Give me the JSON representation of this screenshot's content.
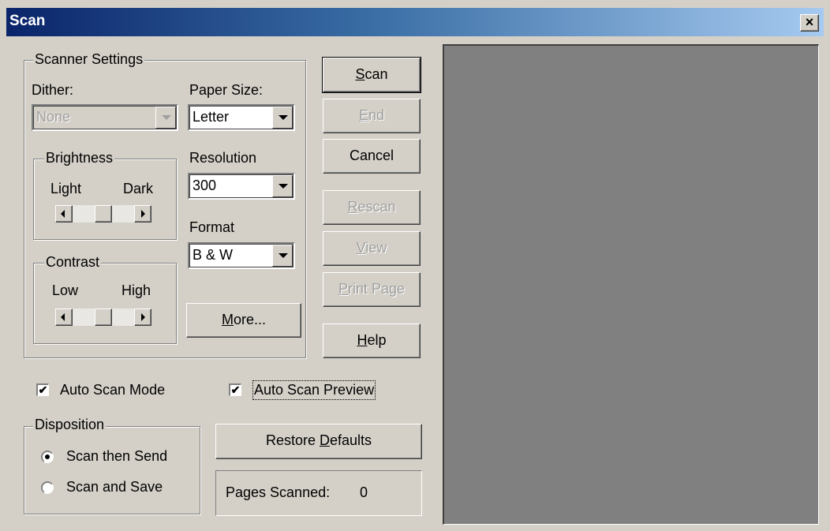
{
  "window": {
    "title": "Scan",
    "close_glyph": "×"
  },
  "scanner_settings": {
    "legend": "Scanner Settings",
    "dither": {
      "label": "Dither:",
      "value": "None",
      "enabled": false
    },
    "paper_size": {
      "label": "Paper Size:",
      "value": "Letter"
    },
    "resolution": {
      "label": "Resolution",
      "value": "300"
    },
    "format": {
      "label": "Format",
      "value": "B & W"
    },
    "brightness": {
      "legend": "Brightness",
      "min_label": "Light",
      "max_label": "Dark",
      "level": 0.5
    },
    "contrast": {
      "legend": "Contrast",
      "min_label": "Low",
      "max_label": "High",
      "level": 0.5
    },
    "more_button": {
      "label_mnemonic": "M",
      "label_rest": "ore..."
    }
  },
  "actions": {
    "scan": {
      "mnemonic": "S",
      "rest": "can",
      "enabled": true,
      "default": true
    },
    "end": {
      "mnemonic": "E",
      "rest": "nd",
      "enabled": false
    },
    "cancel": {
      "label": "Cancel",
      "enabled": true
    },
    "rescan": {
      "mnemonic": "R",
      "rest": "escan",
      "enabled": false
    },
    "view": {
      "mnemonic": "V",
      "rest": "iew",
      "enabled": false
    },
    "print_page": {
      "mnemonic": "P",
      "rest": "rint Page",
      "enabled": false
    },
    "help": {
      "mnemonic": "H",
      "rest": "elp",
      "enabled": true
    }
  },
  "options": {
    "auto_scan_mode": {
      "label": "Auto Scan Mode",
      "checked": true
    },
    "auto_scan_preview": {
      "label": "Auto Scan Preview",
      "checked": true
    }
  },
  "disposition": {
    "legend": "Disposition",
    "options": [
      {
        "label": "Scan then Send",
        "selected": true
      },
      {
        "label": "Scan and Save",
        "selected": false
      }
    ]
  },
  "restore_defaults": {
    "pre": "Restore ",
    "mnemonic": "D",
    "rest": "efaults"
  },
  "status": {
    "pages_scanned_label": "Pages Scanned:",
    "pages_scanned_value": "0"
  },
  "icons": {
    "checkmark": "✔",
    "close": "close-icon",
    "dropdown": "chevron-down-icon"
  }
}
